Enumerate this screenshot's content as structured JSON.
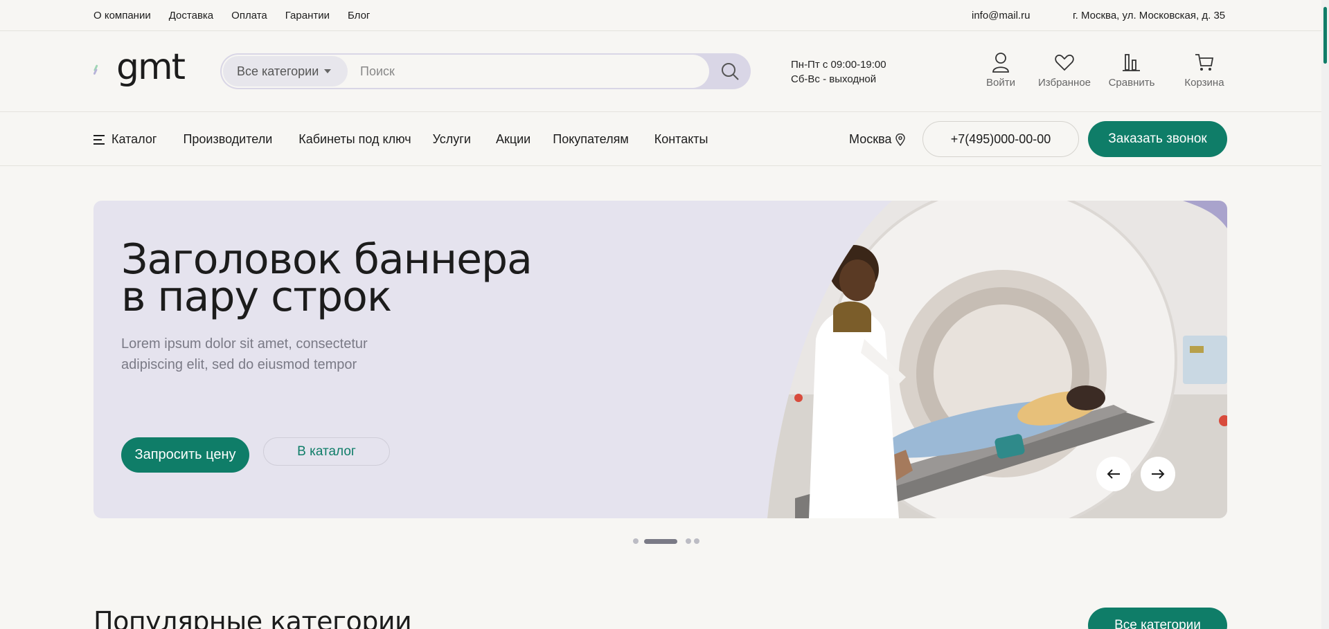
{
  "topbar": {
    "links": [
      "О компании",
      "Доставка",
      "Оплата",
      "Гарантии",
      "Блог"
    ],
    "email": "info@mail.ru",
    "address": "г. Москва, ул. Московская, д. 35"
  },
  "header": {
    "logo_text": "gmt",
    "category_select": "Все категории",
    "search_placeholder": "Поиск",
    "hours_line1": "Пн-Пт с 09:00-19:00",
    "hours_line2": "Сб-Вс - выходной",
    "actions": [
      {
        "label": "Войти",
        "icon": "user-icon"
      },
      {
        "label": "Избранное",
        "icon": "heart-icon"
      },
      {
        "label": "Сравнить",
        "icon": "compare-icon"
      },
      {
        "label": "Корзина",
        "icon": "cart-icon"
      }
    ]
  },
  "nav": {
    "catalog": "Каталог",
    "items": [
      "Производители",
      "Кабинеты под ключ",
      "Услуги",
      "Акции",
      "Покупателям",
      "Контакты"
    ],
    "city": "Москва",
    "phone": "+7(495)000-00-00",
    "call_button": "Заказать звонок"
  },
  "banner": {
    "title_line1": "Заголовок баннера",
    "title_line2": "в пару строк",
    "text_line1": "Lorem ipsum dolor sit amet, consectetur",
    "text_line2": "adipiscing elit, sed do eiusmod tempor",
    "primary_button": "Запросить цену",
    "secondary_button": "В каталог",
    "slides_count": 4,
    "active_slide": 2
  },
  "popular": {
    "title": "Популярные категории",
    "all_button": "Все категории"
  },
  "colors": {
    "accent": "#0f7d68",
    "background": "#f7f6f3",
    "banner_bg": "#e5e3ee"
  }
}
